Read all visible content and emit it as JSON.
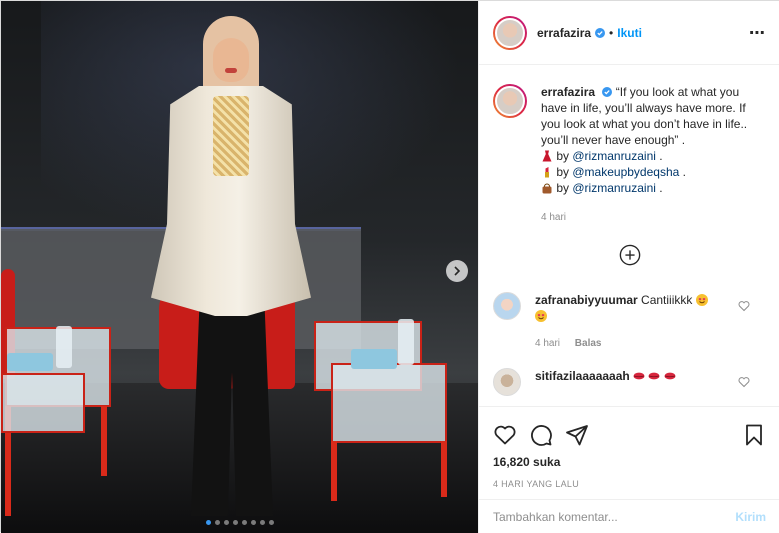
{
  "post": {
    "username": "errafazira",
    "follow_label": "Ikuti",
    "separator": "•",
    "more_icon": "⋯",
    "caption_text": "“If you look at what you have in life, you’ll always have more. If you look at what you don’t have in life.. you’ll never have enough” .",
    "credits": [
      {
        "icon": "dress-emoji",
        "prefix": "by",
        "mention": "@rizmanruzaini",
        "suffix": "."
      },
      {
        "icon": "lipstick-emoji",
        "prefix": "by",
        "mention": "@makeupbydeqsha",
        "suffix": "."
      },
      {
        "icon": "handbag-emoji",
        "prefix": "by",
        "mention": "@rizmanruzaini",
        "suffix": "."
      }
    ],
    "caption_time": "4 hari",
    "likes": "16,820 suka",
    "date": "4 HARI YANG LALU"
  },
  "comments": [
    {
      "username": "zafranabiyyuumar",
      "text": "Cantiiikkk",
      "emoji": [
        "heart-eyes-emoji",
        "heart-eyes-emoji"
      ],
      "time": "4 hari",
      "reply_label": "Balas"
    },
    {
      "username": "sitifazilaaaaaaah",
      "text": "",
      "emoji": [
        "lips-emoji",
        "lips-emoji",
        "lips-emoji"
      ]
    }
  ],
  "add_comment": {
    "placeholder": "Tambahkan komentar...",
    "post_label": "Kirim"
  },
  "carousel": {
    "total": 8,
    "active": 0
  },
  "colors": {
    "accent": "#0095f6",
    "verified": "#3897f0",
    "post_disabled": "#b2dffc"
  }
}
